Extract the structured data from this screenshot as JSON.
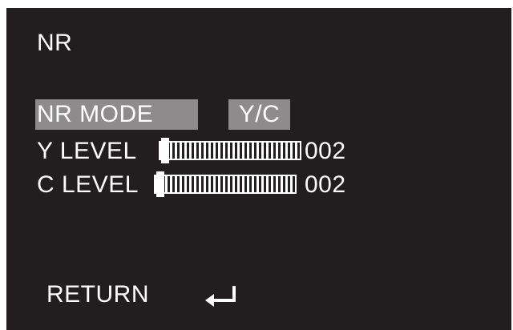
{
  "menu": {
    "title": "NR",
    "nr_mode": {
      "label": "NR MODE",
      "value": "Y/C"
    },
    "y_level": {
      "label": "Y LEVEL",
      "value": "002",
      "level": 0.02
    },
    "c_level": {
      "label": "C LEVEL",
      "value": "002",
      "level": 0.02
    },
    "return_label": "RETURN",
    "return_icon": "enter-arrow-icon"
  },
  "colors": {
    "background": "#211e1f",
    "highlight": "#8d8b8b",
    "text": "#ffffff"
  }
}
